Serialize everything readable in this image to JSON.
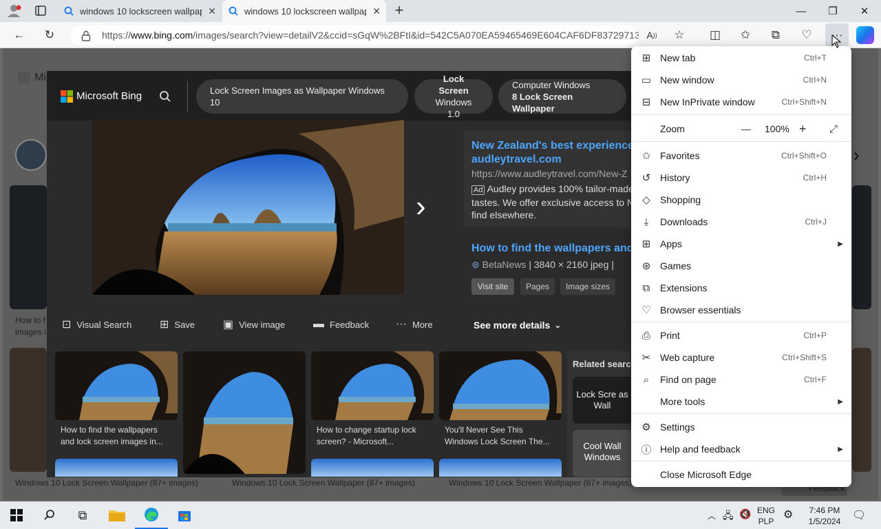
{
  "tabs": [
    {
      "title": "windows 10 lockscreen wallpaper - Search",
      "active": false
    },
    {
      "title": "windows 10 lockscreen wallpaper - Search",
      "active": true
    }
  ],
  "address": {
    "scheme": "https://",
    "host": "www.bing.com",
    "path": "/images/search?view=detailV2&ccid=sGqW%2BFtI&id=542C5A070EA59465469E604CAF6DF83729713..."
  },
  "bing": {
    "logo_text": "Microsoft Bing",
    "pills": [
      {
        "line1": "Lock Screen Images as Wallpaper Windows 10",
        "line2": ""
      },
      {
        "line1": "Lock Screen",
        "line2": "Windows 1.0"
      },
      {
        "line1": "Computer Windows",
        "line2": "8 Lock Screen Wallpaper"
      }
    ],
    "ad": {
      "title_line1": "New Zealand's best experiences",
      "title_line2": "audleytravel.com",
      "url": "https://www.audleytravel.com/New-Z",
      "badge": "Ad",
      "desc_line1": "Audley provides 100% tailor-made",
      "desc_line2": "tastes. We offer exclusive access to N",
      "desc_line3": "find elsewhere."
    },
    "result": {
      "title": "How to find the wallpapers and l",
      "source": "BetaNews",
      "meta": "3840 × 2160 jpeg",
      "buttons": [
        "Visit site",
        "Pages",
        "Image sizes"
      ]
    },
    "actions": [
      "Visual Search",
      "Save",
      "View image",
      "Feedback",
      "More"
    ],
    "see_more": "See more details",
    "related_label": "Related search",
    "related": [
      "Lock Scre as Wall",
      "Cool Wall Windows"
    ],
    "thumbs": [
      {
        "caption_line1": "How to find the wallpapers",
        "caption_line2": "and lock screen images in..."
      },
      {
        "caption_line1": "",
        "caption_line2": ""
      },
      {
        "caption_line1": "How to change startup lock",
        "caption_line2": "screen? - Microsoft..."
      },
      {
        "caption_line1": "You'll Never See This",
        "caption_line2": "Windows Lock Screen The..."
      }
    ],
    "bottom_captions": [
      "Windows 10 Lock Screen Wallpaper (87+ images)",
      "Windows 10 Lock Screen Wallpaper (87+ images)",
      "Windows 10 Lock Screen Wallpaper (87+ images)"
    ],
    "behind_left": [
      "How to f",
      "images i"
    ],
    "behind_logo": "Mi",
    "behind_feedback": "Feedback"
  },
  "menu": {
    "new_tab": {
      "label": "New tab",
      "shortcut": "Ctrl+T"
    },
    "new_window": {
      "label": "New window",
      "shortcut": "Ctrl+N"
    },
    "new_inprivate": {
      "label": "New InPrivate window",
      "shortcut": "Ctrl+Shift+N"
    },
    "zoom": {
      "label": "Zoom",
      "minus": "—",
      "value": "100%",
      "plus": "+"
    },
    "favorites": {
      "label": "Favorites",
      "shortcut": "Ctrl+Shift+O"
    },
    "history": {
      "label": "History",
      "shortcut": "Ctrl+H"
    },
    "shopping": {
      "label": "Shopping",
      "shortcut": ""
    },
    "downloads": {
      "label": "Downloads",
      "shortcut": "Ctrl+J"
    },
    "apps": {
      "label": "Apps",
      "shortcut": ""
    },
    "games": {
      "label": "Games",
      "shortcut": ""
    },
    "extensions": {
      "label": "Extensions",
      "shortcut": ""
    },
    "browser_essentials": {
      "label": "Browser essentials",
      "shortcut": ""
    },
    "print": {
      "label": "Print",
      "shortcut": "Ctrl+P"
    },
    "web_capture": {
      "label": "Web capture",
      "shortcut": "Ctrl+Shift+S"
    },
    "find_on_page": {
      "label": "Find on page",
      "shortcut": "Ctrl+F"
    },
    "more_tools": {
      "label": "More tools",
      "shortcut": ""
    },
    "settings": {
      "label": "Settings",
      "shortcut": ""
    },
    "help": {
      "label": "Help and feedback",
      "shortcut": ""
    },
    "close_edge": {
      "label": "Close Microsoft Edge",
      "shortcut": ""
    }
  },
  "taskbar": {
    "lang1": "ENG",
    "lang2": "PLP",
    "time": "7:46 PM",
    "date": "1/5/2024"
  },
  "colors": {
    "link": "#4ea5ff",
    "bing_dark": "#2b2b2b",
    "menu_bg": "#ffffff",
    "copilot": "#1a73e8"
  }
}
